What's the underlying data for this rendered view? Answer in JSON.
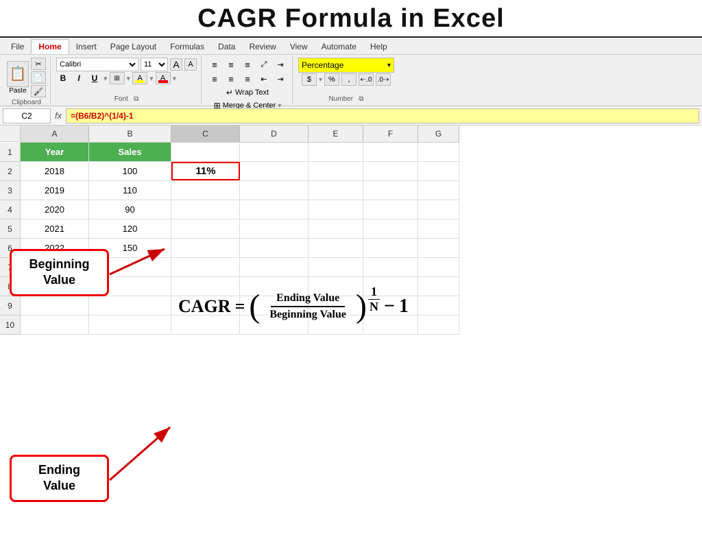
{
  "title": "CAGR Formula in Excel",
  "ribbon": {
    "tabs": [
      "File",
      "Home",
      "Insert",
      "Page Layout",
      "Formulas",
      "Data",
      "Review",
      "View",
      "Automate",
      "Help"
    ],
    "active_tab": "Home",
    "font": {
      "name": "Calibri",
      "size": "11",
      "size_up": "A",
      "size_down": "A"
    },
    "alignment": {
      "wrap_text": "Wrap Text",
      "merge_center": "Merge & Center"
    },
    "number": {
      "format": "Percentage"
    }
  },
  "formula_bar": {
    "name_box": "C2",
    "fx": "fx",
    "formula": "=(B6/B2)^(1/4)-1"
  },
  "columns": {
    "headers": [
      "A",
      "B",
      "C",
      "D",
      "E",
      "F",
      "G"
    ],
    "widths": [
      100,
      120,
      100,
      100,
      80,
      80,
      60
    ]
  },
  "rows": [
    {
      "num": 1,
      "a": "Year",
      "b": "Sales",
      "c": "",
      "d": "",
      "e": "",
      "f": ""
    },
    {
      "num": 2,
      "a": "2018",
      "b": "100",
      "c": "11%",
      "d": "",
      "e": "",
      "f": ""
    },
    {
      "num": 3,
      "a": "2019",
      "b": "110",
      "c": "",
      "d": "",
      "e": "",
      "f": ""
    },
    {
      "num": 4,
      "a": "2020",
      "b": "90",
      "c": "",
      "d": "",
      "e": "",
      "f": ""
    },
    {
      "num": 5,
      "a": "2021",
      "b": "120",
      "c": "",
      "d": "",
      "e": "",
      "f": ""
    },
    {
      "num": 6,
      "a": "2022",
      "b": "150",
      "c": "",
      "d": "",
      "e": "",
      "f": ""
    },
    {
      "num": 7,
      "a": "",
      "b": "",
      "c": "",
      "d": "",
      "e": "",
      "f": ""
    },
    {
      "num": 8,
      "a": "",
      "b": "",
      "c": "",
      "d": "",
      "e": "",
      "f": ""
    },
    {
      "num": 9,
      "a": "",
      "b": "",
      "c": "",
      "d": "",
      "e": "",
      "f": ""
    },
    {
      "num": 10,
      "a": "",
      "b": "",
      "c": "",
      "d": "",
      "e": "",
      "f": ""
    }
  ],
  "callouts": {
    "beginning": "Beginning\nValue",
    "ending": "Ending\nValue"
  },
  "formula_display": {
    "label": "CAGR",
    "equals": "=",
    "paren_open": "(",
    "numerator": "Ending Value",
    "denominator": "Beginning Value",
    "paren_close": ")",
    "exp_num": "1",
    "exp_den": "N",
    "minus": "−",
    "one": "1"
  }
}
